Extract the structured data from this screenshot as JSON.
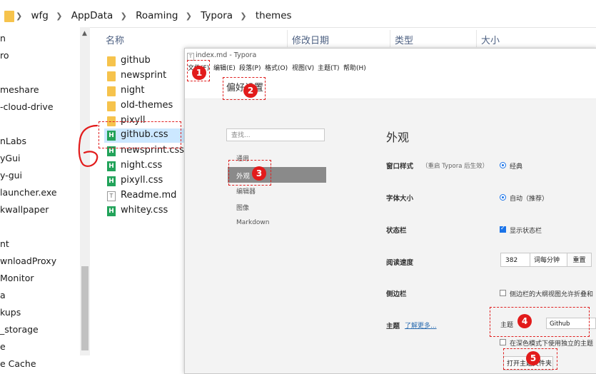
{
  "explorer": {
    "breadcrumb": [
      "wfg",
      "AppData",
      "Roaming",
      "Typora",
      "themes"
    ],
    "nav_items": [
      "n",
      "ro",
      "meshare",
      "-cloud-drive",
      "nLabs",
      "yGui",
      "y-gui",
      "launcher.exe",
      "kwallpaper",
      "nt",
      "wnloadProxy",
      "Monitor",
      "a",
      "kups",
      "_storage",
      "e",
      "e Cache"
    ],
    "columns": [
      "名称",
      "修改日期",
      "类型",
      "大小"
    ],
    "files": [
      {
        "name": "github",
        "type": "folder"
      },
      {
        "name": "newsprint",
        "type": "folder"
      },
      {
        "name": "night",
        "type": "folder"
      },
      {
        "name": "old-themes",
        "type": "folder"
      },
      {
        "name": "pixyll",
        "type": "folder"
      },
      {
        "name": "github.css",
        "type": "css"
      },
      {
        "name": "newsprint.css",
        "type": "css"
      },
      {
        "name": "night.css",
        "type": "css"
      },
      {
        "name": "pixyll.css",
        "type": "css"
      },
      {
        "name": "Readme.md",
        "type": "md"
      },
      {
        "name": "whitey.css",
        "type": "css"
      }
    ],
    "selected_file": "github.css"
  },
  "typora": {
    "title": "index.md - Typora",
    "menu": [
      "文件(F)",
      "编辑(E)",
      "段落(P)",
      "格式(O)",
      "视图(V)",
      "主题(T)",
      "帮助(H)"
    ],
    "pref_tab": "偏好设置",
    "search_placeholder": "查找...",
    "sidebar": [
      "通用",
      "外观",
      "编辑器",
      "图像",
      "Markdown"
    ],
    "active_sidebar": "外观",
    "section_title": "外观",
    "rows": {
      "window_style": {
        "label": "窗口样式",
        "note": "（重启 Typora 后生效）",
        "value": "经典"
      },
      "font_size": {
        "label": "字体大小",
        "value": "自动（推荐）"
      },
      "status_bar": {
        "label": "状态栏",
        "value": "显示状态栏",
        "checked": true
      },
      "reading_speed": {
        "label": "阅读速度",
        "value": "382",
        "unit": "词每分钟",
        "reset": "重置"
      },
      "sidebar": {
        "label": "侧边栏",
        "value": "侧边栏的大纲视图允许折叠和",
        "checked": false
      },
      "theme": {
        "label": "主题",
        "link": "了解更多...",
        "sub_label": "主题",
        "value": "Github",
        "dark_option": "在深色模式下使用独立的主题",
        "open_button": "打开主题文件夹"
      }
    }
  },
  "annotations": [
    "1",
    "2",
    "3",
    "4",
    "5"
  ],
  "colors": {
    "annotation": "#e21b1b",
    "accent": "#1a73e8",
    "selection": "#cce8ff",
    "sidebar_active": "#8a8a8a"
  }
}
